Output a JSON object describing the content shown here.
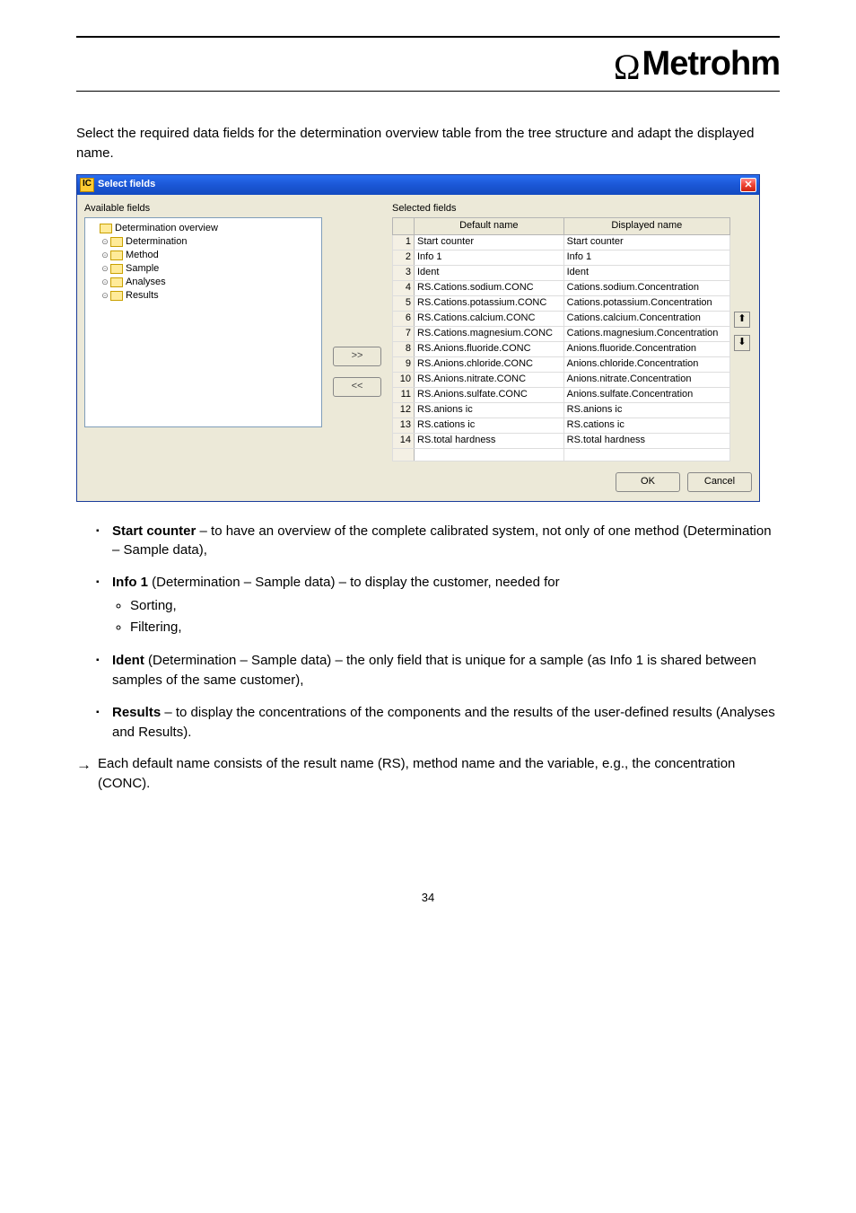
{
  "brand": "Metrohm",
  "intro_paragraph": "Select the required data fields for the determination overview table from the tree structure and adapt the displayed name.",
  "bullets": [
    {
      "lead": "Start counter",
      "rest": " – to have an overview of the complete calibrated system, not only of one method (Determination – Sample data),"
    },
    {
      "lead": "Info 1",
      "rest": " (Determination – Sample data) – to display the customer, needed for",
      "sublist": [
        "Sorting,",
        "Filtering,"
      ]
    },
    {
      "lead": "Ident",
      "rest": " (Determination – Sample data) – the only field that is unique for a sample (as Info 1 is shared between samples of the same customer),"
    },
    {
      "lead": "Results",
      "rest": " – to display the concentrations of the components and the results of the user-defined results (Analyses and Results)."
    }
  ],
  "arrow_text": "Each default name consists of the result name (RS), method name and the variable, e.g., the concentration (CONC).",
  "page_number": "34",
  "dialog": {
    "title": "Select fields",
    "icon_letter": "IC",
    "left_label": "Available fields",
    "right_label": "Selected fields",
    "move_right": ">>",
    "move_left": "<<",
    "ok_label": "OK",
    "cancel_label": "Cancel",
    "up_glyph": "⬆",
    "down_glyph": "⬇",
    "tree": [
      {
        "label": "Determination overview",
        "expander": ""
      },
      {
        "label": "Determination",
        "expander": "⊙",
        "child": true
      },
      {
        "label": "Method",
        "expander": "⊙",
        "child": true
      },
      {
        "label": "Sample",
        "expander": "⊙",
        "child": true
      },
      {
        "label": "Analyses",
        "expander": "⊙",
        "child": true
      },
      {
        "label": "Results",
        "expander": "⊙",
        "child": true
      }
    ],
    "columns": [
      "",
      "Default name",
      "Displayed name"
    ],
    "rows": [
      {
        "n": "1",
        "def": "Start counter",
        "disp": "Start counter"
      },
      {
        "n": "2",
        "def": "Info 1",
        "disp": "Info 1"
      },
      {
        "n": "3",
        "def": "Ident",
        "disp": "Ident"
      },
      {
        "n": "4",
        "def": "RS.Cations.sodium.CONC",
        "disp": "Cations.sodium.Concentration"
      },
      {
        "n": "5",
        "def": "RS.Cations.potassium.CONC",
        "disp": "Cations.potassium.Concentration"
      },
      {
        "n": "6",
        "def": "RS.Cations.calcium.CONC",
        "disp": "Cations.calcium.Concentration"
      },
      {
        "n": "7",
        "def": "RS.Cations.magnesium.CONC",
        "disp": "Cations.magnesium.Concentration"
      },
      {
        "n": "8",
        "def": "RS.Anions.fluoride.CONC",
        "disp": "Anions.fluoride.Concentration"
      },
      {
        "n": "9",
        "def": "RS.Anions.chloride.CONC",
        "disp": "Anions.chloride.Concentration"
      },
      {
        "n": "10",
        "def": "RS.Anions.nitrate.CONC",
        "disp": "Anions.nitrate.Concentration"
      },
      {
        "n": "11",
        "def": "RS.Anions.sulfate.CONC",
        "disp": "Anions.sulfate.Concentration"
      },
      {
        "n": "12",
        "def": "RS.anions ic",
        "disp": "RS.anions ic"
      },
      {
        "n": "13",
        "def": "RS.cations ic",
        "disp": "RS.cations ic"
      },
      {
        "n": "14",
        "def": "RS.total hardness",
        "disp": "RS.total hardness"
      }
    ]
  }
}
